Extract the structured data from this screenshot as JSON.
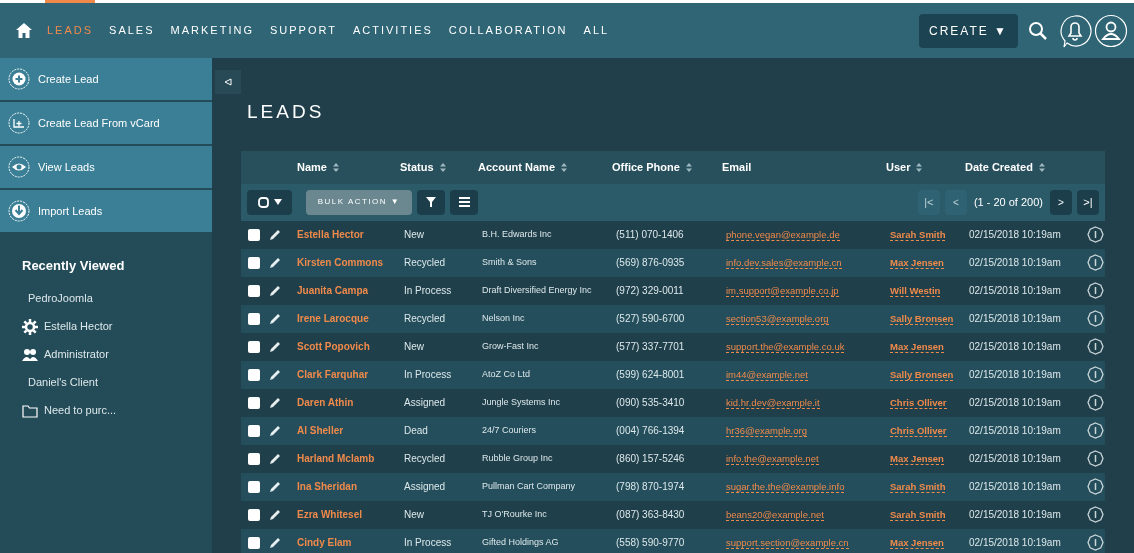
{
  "nav": {
    "tabs": [
      {
        "label": "LEADS",
        "selected": true
      },
      {
        "label": "SALES",
        "selected": false
      },
      {
        "label": "MARKETING",
        "selected": false
      },
      {
        "label": "SUPPORT",
        "selected": false
      },
      {
        "label": "ACTIVITIES",
        "selected": false
      },
      {
        "label": "COLLABORATION",
        "selected": false
      },
      {
        "label": "ALL",
        "selected": false
      }
    ],
    "create_button": "CREATE ▼"
  },
  "sidebar": {
    "actions": [
      {
        "label": "Create Lead",
        "kind": "plus"
      },
      {
        "label": "Create Lead From vCard",
        "kind": "vcard"
      },
      {
        "label": "View Leads",
        "kind": "eye"
      },
      {
        "label": "Import Leads",
        "kind": "download"
      }
    ],
    "recently_viewed_title": "Recently Viewed",
    "recently_viewed": [
      {
        "label": "PedroJoomla",
        "kind": "none"
      },
      {
        "label": "Estella Hector",
        "kind": "gear"
      },
      {
        "label": "Administrator",
        "kind": "users"
      },
      {
        "label": "Daniel's Client",
        "kind": "none"
      },
      {
        "label": "Need to purc...",
        "kind": "folder"
      }
    ]
  },
  "page_title": "LEADS",
  "table": {
    "columns": [
      {
        "label": "Name",
        "sortable": true
      },
      {
        "label": "Status",
        "sortable": true
      },
      {
        "label": "Account Name",
        "sortable": true
      },
      {
        "label": "Office Phone",
        "sortable": true
      },
      {
        "label": "Email",
        "sortable": false
      },
      {
        "label": "User",
        "sortable": true
      },
      {
        "label": "Date Created",
        "sortable": true
      }
    ],
    "toolbar": {
      "bulk_action": "BULK ACTION ▼",
      "first_page": "|<",
      "previous_page": "<",
      "pagination": "(1 - 20 of 200)",
      "next_page": ">",
      "last_page": ">|"
    },
    "rows": [
      {
        "name": "Estella Hector",
        "status": "New",
        "account": "B.H. Edwards Inc",
        "phone": "(511) 070-1406",
        "email": "phone.vegan@example.de",
        "user": "Sarah Smith",
        "date": "02/15/2018 10:19am",
        "checked": false
      },
      {
        "name": "Kirsten Commons",
        "status": "Recycled",
        "account": "Smith & Sons",
        "phone": "(569) 876-0935",
        "email": "info.dev.sales@example.cn",
        "user": "Max Jensen",
        "date": "02/15/2018 10:19am",
        "checked": false
      },
      {
        "name": "Juanita Campa",
        "status": "In Process",
        "account": "Draft Diversified Energy Inc",
        "phone": "(972) 329-0011",
        "email": "im.support@example.co.jp",
        "user": "Will Westin",
        "date": "02/15/2018 10:19am",
        "checked": false
      },
      {
        "name": "Irene Larocque",
        "status": "Recycled",
        "account": "Nelson Inc",
        "phone": "(527) 590-6700",
        "email": "section53@example.org",
        "user": "Sally Bronsen",
        "date": "02/15/2018 10:19am",
        "checked": false
      },
      {
        "name": "Scott Popovich",
        "status": "New",
        "account": "Grow-Fast Inc",
        "phone": "(577) 337-7701",
        "email": "support.the@example.co.uk",
        "user": "Max Jensen",
        "date": "02/15/2018 10:19am",
        "checked": false
      },
      {
        "name": "Clark Farquhar",
        "status": "In Process",
        "account": "AtoZ Co Ltd",
        "phone": "(599) 624-8001",
        "email": "im44@example.net",
        "user": "Sally Bronsen",
        "date": "02/15/2018 10:19am",
        "checked": false
      },
      {
        "name": "Daren Athin",
        "status": "Assigned",
        "account": "Jungle Systems Inc",
        "phone": "(090) 535-3410",
        "email": "kid.hr.dev@example.it",
        "user": "Chris Olliver",
        "date": "02/15/2018 10:19am",
        "checked": false
      },
      {
        "name": "Al Sheller",
        "status": "Dead",
        "account": "24/7 Couriers",
        "phone": "(004) 766-1394",
        "email": "hr36@example.org",
        "user": "Chris Olliver",
        "date": "02/15/2018 10:19am",
        "checked": false
      },
      {
        "name": "Harland Mclamb",
        "status": "Recycled",
        "account": "Rubble Group Inc",
        "phone": "(860) 157-5246",
        "email": "info.the@example.net",
        "user": "Max Jensen",
        "date": "02/15/2018 10:19am",
        "checked": false
      },
      {
        "name": "Ina Sheridan",
        "status": "Assigned",
        "account": "Pullman Cart Company",
        "phone": "(798) 870-1974",
        "email": "sugar.the.the@example.info",
        "user": "Sarah Smith",
        "date": "02/15/2018 10:19am",
        "checked": false
      },
      {
        "name": "Ezra Whitesel",
        "status": "New",
        "account": "TJ O'Rourke Inc",
        "phone": "(087) 363-8430",
        "email": "beans20@example.net",
        "user": "Sarah Smith",
        "date": "02/15/2018 10:19am",
        "checked": false
      },
      {
        "name": "Cindy Elam",
        "status": "In Process",
        "account": "Gifted Holdings AG",
        "phone": "(558) 590-9770",
        "email": "support.section@example.cn",
        "user": "Max Jensen",
        "date": "02/15/2018 10:19am",
        "checked": false
      }
    ]
  }
}
